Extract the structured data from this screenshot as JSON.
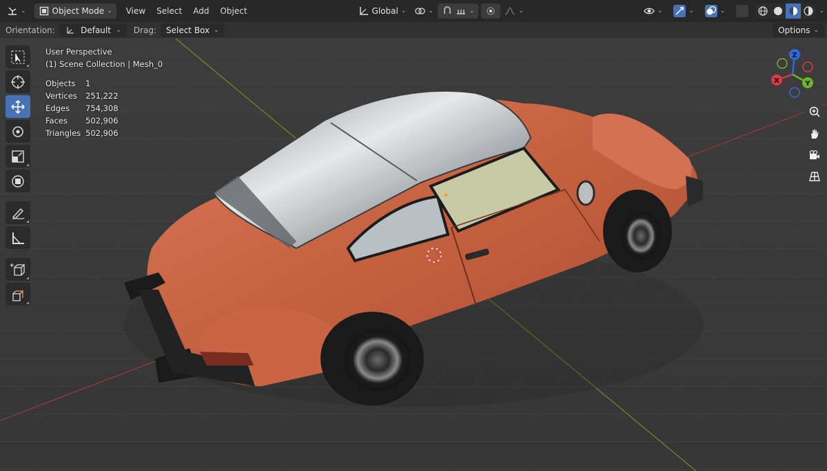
{
  "header": {
    "editor_type_icon": "view3d-icon",
    "mode": "Object Mode",
    "menus": [
      "View",
      "Select",
      "Add",
      "Object"
    ],
    "transform_orientation": "Global",
    "icons": {
      "pivot": "pivot-icon",
      "snap": "snap-icon",
      "snap_increment": "snap-increment-icon",
      "proportional": "proportional-edit-icon",
      "falloff": "falloff-icon",
      "visibility": "eye-icon",
      "gizmo": "gizmo-icon",
      "overlay": "overlay-icon",
      "xray": "xray-icon"
    },
    "shading_modes": [
      "wireframe",
      "solid",
      "material-preview",
      "rendered"
    ],
    "active_shading": "material-preview"
  },
  "tool_settings": {
    "orientation_label": "Orientation:",
    "orientation_value": "Default",
    "drag_label": "Drag:",
    "drag_value": "Select Box",
    "options_label": "Options"
  },
  "tools": [
    {
      "name": "select-box-tool",
      "icon": "select-box-icon",
      "active": false
    },
    {
      "name": "cursor-tool",
      "icon": "cursor-icon",
      "active": false
    },
    {
      "name": "move-tool",
      "icon": "move-icon",
      "active": true
    },
    {
      "name": "rotate-tool",
      "icon": "rotate-icon",
      "active": false
    },
    {
      "name": "scale-tool",
      "icon": "scale-icon",
      "active": false
    },
    {
      "name": "transform-tool",
      "icon": "transform-icon",
      "active": false
    },
    {
      "name": "annotate-tool",
      "icon": "annotate-icon",
      "active": false
    },
    {
      "name": "measure-tool",
      "icon": "measure-icon",
      "active": false
    },
    {
      "name": "add-cube-tool",
      "icon": "add-cube-icon",
      "active": false
    },
    {
      "name": "extrude-tool",
      "icon": "extrude-icon",
      "active": false
    }
  ],
  "viewport": {
    "perspective": "User Perspective",
    "collection": "(1) Scene Collection | Mesh_0",
    "stats": [
      {
        "label": "Objects",
        "value": "1"
      },
      {
        "label": "Vertices",
        "value": "251,222"
      },
      {
        "label": "Edges",
        "value": "754,308"
      },
      {
        "label": "Faces",
        "value": "502,906"
      },
      {
        "label": "Triangles",
        "value": "502,906"
      }
    ],
    "object": "car-mesh"
  },
  "gizmo": {
    "axes": [
      {
        "label": "Z",
        "color": "#2f6bd8"
      },
      {
        "label": "Y",
        "color": "#6fb32a"
      },
      {
        "label": "X",
        "color": "#d83a4a"
      }
    ]
  },
  "nav_buttons": [
    "zoom-icon",
    "hand-icon",
    "camera-icon",
    "grid-icon"
  ],
  "colors": {
    "accent": "#4772b3",
    "x_axis": "#a83a3a",
    "y_axis": "#7c8a25",
    "grid_bg": "#3a3a3a",
    "car_paint": "#c7664a"
  }
}
